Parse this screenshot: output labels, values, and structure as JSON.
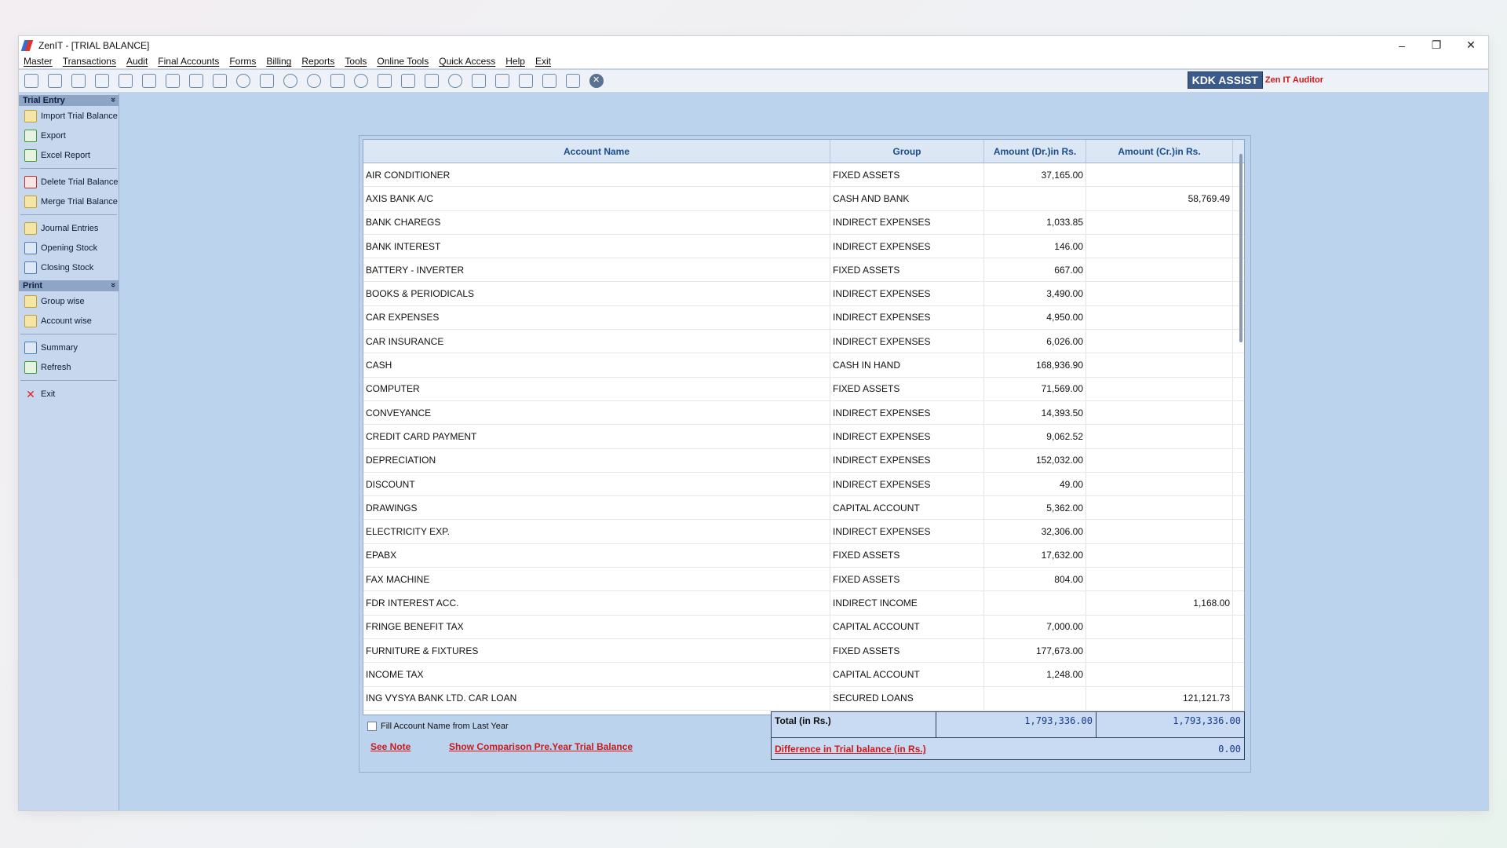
{
  "window": {
    "title": "ZenIT - [TRIAL BALANCE]"
  },
  "menu": [
    "Master",
    "Transactions",
    "Audit",
    "Final Accounts",
    "Forms",
    "Billing",
    "Reports",
    "Tools",
    "Online Tools",
    "Quick Access",
    "Help",
    "Exit"
  ],
  "brand": {
    "badge": "KDK ASSIST",
    "text": "Zen IT Auditor"
  },
  "sidebar": {
    "section1": "Trial Entry",
    "items1": [
      "Import Trial Balance",
      "Export",
      "Excel Report"
    ],
    "items2": [
      "Delete Trial Balance",
      "Merge Trial Balance"
    ],
    "items3": [
      "Journal Entries",
      "Opening Stock",
      "Closing Stock"
    ],
    "section2": "Print",
    "items4": [
      "Group wise",
      "Account wise"
    ],
    "items5": [
      "Summary",
      "Refresh"
    ],
    "items6": [
      "Exit"
    ]
  },
  "grid": {
    "headers": [
      "Account Name",
      "Group",
      "Amount (Dr.)in Rs.",
      "Amount (Cr.)in Rs."
    ],
    "rows": [
      [
        "AIR CONDITIONER",
        "FIXED ASSETS",
        "37,165.00",
        ""
      ],
      [
        "AXIS BANK A/C",
        "CASH AND BANK",
        "",
        "58,769.49"
      ],
      [
        "BANK CHAREGS",
        "INDIRECT EXPENSES",
        "1,033.85",
        ""
      ],
      [
        "BANK INTEREST",
        "INDIRECT EXPENSES",
        "146.00",
        ""
      ],
      [
        "BATTERY - INVERTER",
        "FIXED ASSETS",
        "667.00",
        ""
      ],
      [
        "BOOKS & PERIODICALS",
        "INDIRECT EXPENSES",
        "3,490.00",
        ""
      ],
      [
        "CAR EXPENSES",
        "INDIRECT EXPENSES",
        "4,950.00",
        ""
      ],
      [
        "CAR INSURANCE",
        "INDIRECT EXPENSES",
        "6,026.00",
        ""
      ],
      [
        "CASH",
        "CASH IN HAND",
        "168,936.90",
        ""
      ],
      [
        "COMPUTER",
        "FIXED ASSETS",
        "71,569.00",
        ""
      ],
      [
        "CONVEYANCE",
        "INDIRECT EXPENSES",
        "14,393.50",
        ""
      ],
      [
        "CREDIT CARD PAYMENT",
        "INDIRECT EXPENSES",
        "9,062.52",
        ""
      ],
      [
        "DEPRECIATION",
        "INDIRECT EXPENSES",
        "152,032.00",
        ""
      ],
      [
        "DISCOUNT",
        "INDIRECT EXPENSES",
        "49.00",
        ""
      ],
      [
        "DRAWINGS",
        "CAPITAL ACCOUNT",
        "5,362.00",
        ""
      ],
      [
        "ELECTRICITY EXP.",
        "INDIRECT EXPENSES",
        "32,306.00",
        ""
      ],
      [
        "EPABX",
        "FIXED ASSETS",
        "17,632.00",
        ""
      ],
      [
        "FAX MACHINE",
        "FIXED ASSETS",
        "804.00",
        ""
      ],
      [
        "FDR INTEREST ACC.",
        "INDIRECT INCOME",
        "",
        "1,168.00"
      ],
      [
        "FRINGE BENEFIT TAX",
        "CAPITAL ACCOUNT",
        "7,000.00",
        ""
      ],
      [
        "FURNITURE & FIXTURES",
        "FIXED ASSETS",
        "177,673.00",
        ""
      ],
      [
        "INCOME TAX",
        "CAPITAL ACCOUNT",
        "1,248.00",
        ""
      ],
      [
        "ING VYSYA BANK LTD. CAR LOAN",
        "SECURED LOANS",
        "",
        "121,121.73"
      ]
    ]
  },
  "footer": {
    "fill_label": "Fill Account Name from Last Year",
    "see_note": "See Note",
    "comparison": "Show Comparison Pre.Year Trial Balance",
    "total_label": "Total (in Rs.)",
    "total_dr": "1,793,336.00",
    "total_cr": "1,793,336.00",
    "diff_label": "Difference in Trial balance (in Rs.)",
    "diff_value": "0.00"
  }
}
